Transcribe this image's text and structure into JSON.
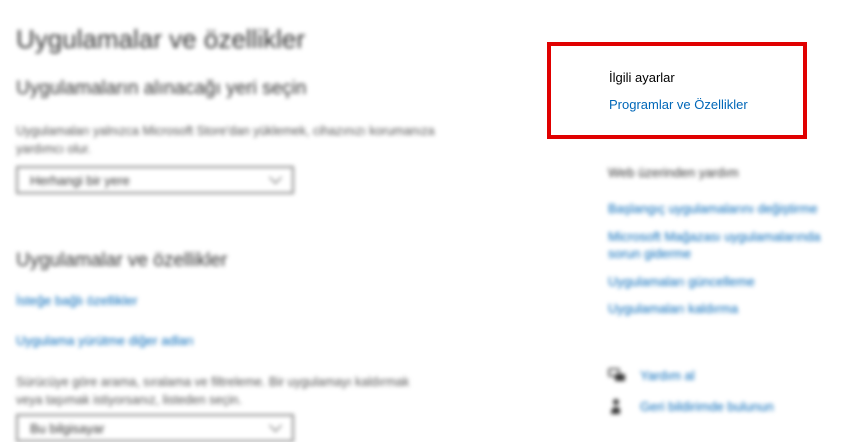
{
  "main": {
    "title": "Uygulamalar ve özellikler",
    "install_source": {
      "heading": "Uygulamaların alınacağı yeri seçin",
      "description": "Uygulamaları yalnızca Microsoft Store'dan yüklemek, cihazınızı korumanıza yardımcı olur.",
      "dropdown_value": "Herhangi bir yere"
    },
    "apps_section": {
      "heading": "Uygulamalar ve özellikler",
      "link_optional": "İsteğe bağlı özellikler",
      "link_alias": "Uygulama yürütme diğer adları",
      "description": "Sürücüye göre arama, sıralama ve filtreleme. Bir uygulamayı kaldırmak veya taşımak istiyorsanız, listeden seçin.",
      "dropdown_value": "Bu bilgisayar"
    }
  },
  "related": {
    "title": "İlgili ayarlar",
    "link": "Programlar ve Özellikler"
  },
  "web_help": {
    "heading": "Web üzerinden yardım",
    "links": [
      "Başlangıç uygulamalarını değiştirme",
      "Microsoft Mağazası uygulamalarında sorun giderme",
      "Uygulamaları güncelleme",
      "Uygulamaları kaldırma"
    ]
  },
  "support": {
    "get_help": "Yardım al",
    "feedback": "Geri bildirimde bulunun"
  },
  "colors": {
    "link": "#0067b8",
    "highlight": "#e00000"
  }
}
